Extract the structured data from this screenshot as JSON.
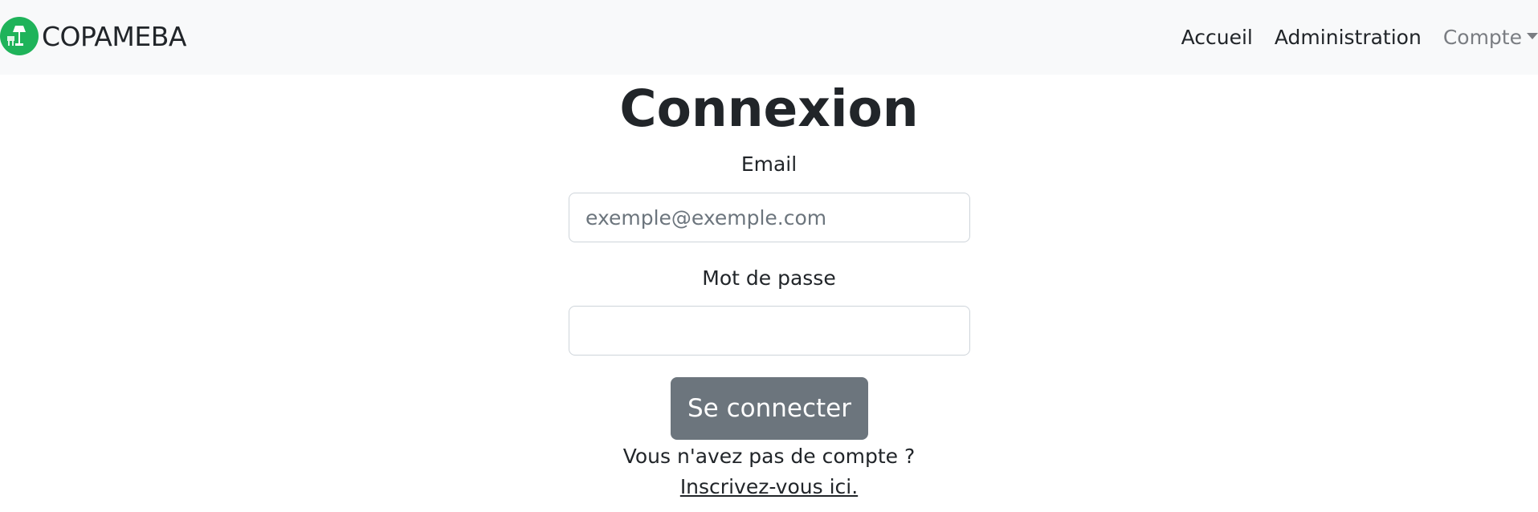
{
  "navbar": {
    "brand": "COPAMEBA",
    "links": {
      "home": "Accueil",
      "admin": "Administration",
      "account": "Compte"
    }
  },
  "main": {
    "title": "Connexion",
    "email_label": "Email",
    "email_placeholder": "exemple@exemple.com",
    "email_value": "",
    "password_label": "Mot de passe",
    "password_value": "",
    "submit_label": "Se connecter",
    "signup_prompt": "Vous n'avez pas de compte ?",
    "signup_link": "Inscrivez-vous ici."
  },
  "colors": {
    "navbar_bg": "#f8f9fa",
    "logo": "#1fb35a",
    "button": "#6c757d"
  }
}
